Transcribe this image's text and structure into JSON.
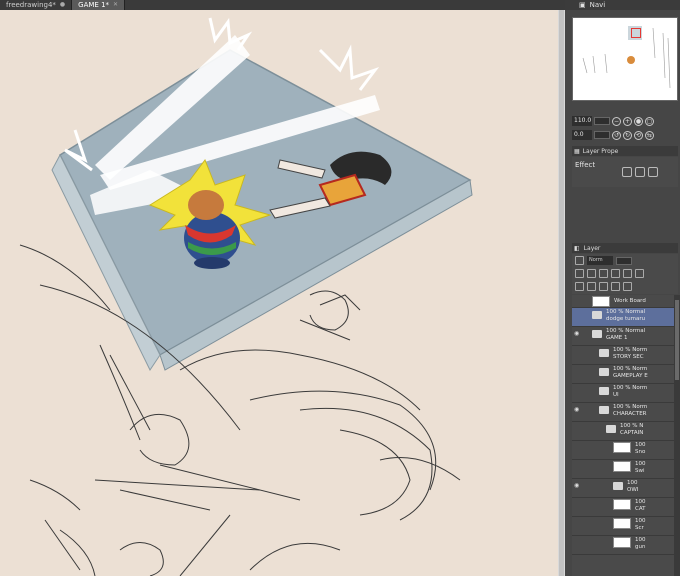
{
  "tabs": [
    {
      "label": "freedrawing4*",
      "active": false
    },
    {
      "label": "GAME 1*",
      "active": true
    }
  ],
  "navigator": {
    "panel_title": "Navi",
    "zoom": "110.0",
    "rotation": "0.0"
  },
  "layer_property": {
    "title": "Layer Prope",
    "effect_label": "Effect"
  },
  "layer_panel": {
    "title": "Layer",
    "blend_mode": "Norm"
  },
  "layers": [
    {
      "name": "Work Board",
      "opacity": "",
      "kind": "paper",
      "indent": 0,
      "visible": false,
      "selected": false
    },
    {
      "name": "dodge tumaru",
      "opacity": "100 % Normal",
      "kind": "folder",
      "indent": 0,
      "visible": false,
      "selected": true
    },
    {
      "name": "GAME 1",
      "opacity": "100 % Normal",
      "kind": "folder",
      "indent": 0,
      "visible": true,
      "selected": false
    },
    {
      "name": "STORY SEC",
      "opacity": "100 % Norm",
      "kind": "folder",
      "indent": 1,
      "visible": false,
      "selected": false
    },
    {
      "name": "GAMEPLAY E",
      "opacity": "100 % Norm",
      "kind": "folder",
      "indent": 1,
      "visible": false,
      "selected": false
    },
    {
      "name": "UI",
      "opacity": "100 % Norm",
      "kind": "folder",
      "indent": 1,
      "visible": false,
      "selected": false
    },
    {
      "name": "CHARACTER",
      "opacity": "100 % Norm",
      "kind": "folder",
      "indent": 1,
      "visible": true,
      "selected": false
    },
    {
      "name": "CAPTAIN",
      "opacity": "100 % N",
      "kind": "folder",
      "indent": 2,
      "visible": false,
      "selected": false
    },
    {
      "name": "Sno",
      "opacity": "100",
      "kind": "raster",
      "indent": 3,
      "visible": false,
      "selected": false
    },
    {
      "name": "Swi",
      "opacity": "100",
      "kind": "raster",
      "indent": 3,
      "visible": false,
      "selected": false
    },
    {
      "name": "OWI",
      "opacity": "100",
      "kind": "folder",
      "indent": 3,
      "visible": true,
      "selected": false
    },
    {
      "name": "CAT",
      "opacity": "100",
      "kind": "raster",
      "indent": 3,
      "visible": false,
      "selected": false
    },
    {
      "name": "Scr",
      "opacity": "100",
      "kind": "raster",
      "indent": 3,
      "visible": false,
      "selected": false
    },
    {
      "name": "gun",
      "opacity": "100",
      "kind": "raster",
      "indent": 3,
      "visible": false,
      "selected": false
    }
  ]
}
